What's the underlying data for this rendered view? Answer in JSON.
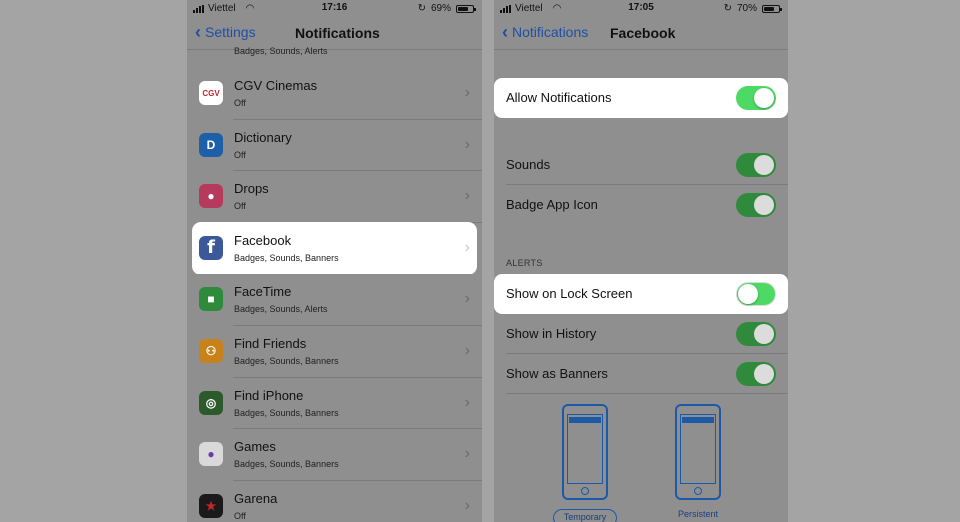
{
  "left": {
    "status": {
      "carrier": "Viettel",
      "time": "17:16",
      "battery": "69%"
    },
    "nav": {
      "back_label": "Settings",
      "title": "Notifications"
    },
    "top_partial_sub": "Badges, Sounds, Alerts",
    "apps": [
      {
        "name": "CGV Cinemas",
        "sub": "Off",
        "icon": "cgv-icon",
        "color": "#ffffff"
      },
      {
        "name": "Dictionary",
        "sub": "Off",
        "icon": "dictionary-icon",
        "color": "#1d5fa8"
      },
      {
        "name": "Drops",
        "sub": "Off",
        "icon": "drops-icon",
        "color": "#b63a5c"
      },
      {
        "name": "Facebook",
        "sub": "Badges, Sounds, Banners",
        "icon": "facebook-icon",
        "color": "#3b5998"
      },
      {
        "name": "FaceTime",
        "sub": "Badges, Sounds, Alerts",
        "icon": "facetime-icon",
        "color": "#2f8a3b"
      },
      {
        "name": "Find Friends",
        "sub": "Badges, Sounds, Banners",
        "icon": "find-friends-icon",
        "color": "#c8821a"
      },
      {
        "name": "Find iPhone",
        "sub": "Badges, Sounds, Banners",
        "icon": "find-iphone-icon",
        "color": "#2c5a2c"
      },
      {
        "name": "Games",
        "sub": "Badges, Sounds, Banners",
        "icon": "games-icon",
        "color": "#e8e8e8"
      },
      {
        "name": "Garena",
        "sub": "Off",
        "icon": "garena-icon",
        "color": "#1a1a1a"
      }
    ]
  },
  "right": {
    "status": {
      "carrier": "Viettel",
      "time": "17:05",
      "battery": "70%"
    },
    "nav": {
      "back_label": "Notifications",
      "title": "Facebook"
    },
    "allow_notifications": {
      "label": "Allow Notifications",
      "on": true
    },
    "sounds": {
      "label": "Sounds",
      "on": true
    },
    "badge_app_icon": {
      "label": "Badge App Icon",
      "on": true
    },
    "alerts_header": "ALERTS",
    "show_on_lock_screen": {
      "label": "Show on Lock Screen",
      "on": false
    },
    "show_in_history": {
      "label": "Show in History",
      "on": true
    },
    "show_as_banners": {
      "label": "Show as Banners",
      "on": true
    },
    "banner_styles": [
      "Temporary",
      "Persistent"
    ],
    "selected_banner_style": "Temporary"
  },
  "colors": {
    "accent": "#1f4fa5",
    "toggle_on": "#4cd964",
    "dimmed_bg": "#8f8f8f"
  }
}
